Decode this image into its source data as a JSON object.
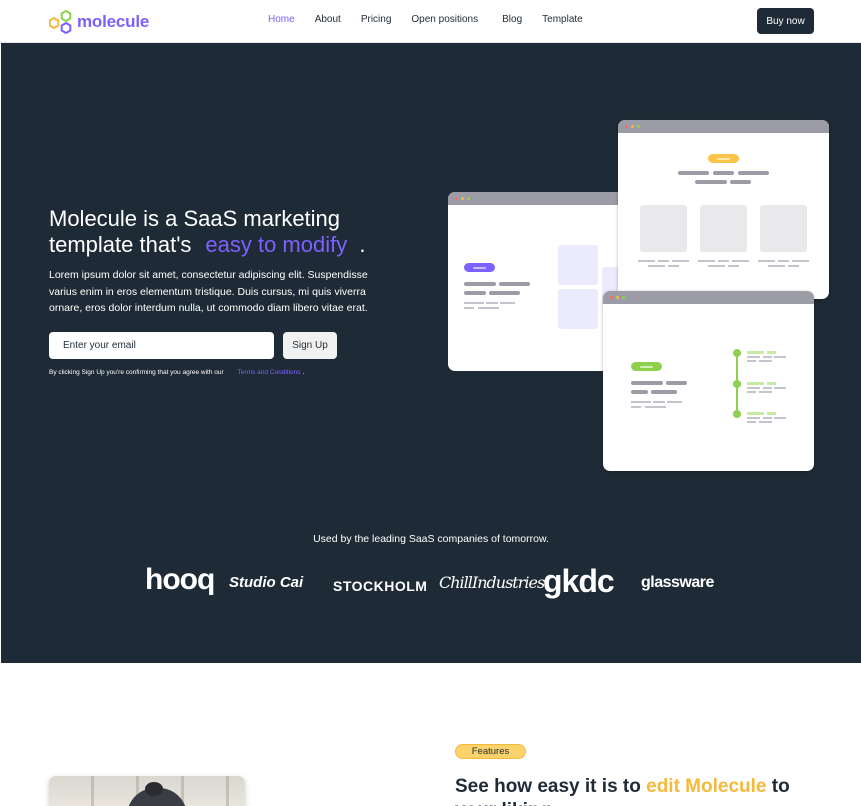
{
  "nav": {
    "logo_text": "molecule",
    "links": [
      "Home",
      "About",
      "Pricing",
      "Open positions",
      "Blog",
      "Template"
    ],
    "active": "Home",
    "buy_label": "Buy now"
  },
  "hero": {
    "title_part1": "Molecule is a SaaS marketing template that's",
    "title_accent": "easy to modify",
    "title_end": ".",
    "description": "Lorem ipsum dolor sit amet, consectetur adipiscing elit. Suspendisse varius enim in eros elementum tristique. Duis cursus, mi quis viverra ornare, eros dolor interdum nulla, ut commodo diam libero vitae erat.",
    "email_placeholder": "Enter your email",
    "signup_label": "Sign Up",
    "consent_text": "By clicking Sign Up you're confirming that you agree with our",
    "terms_text": "Terms and Conditions",
    "consent_end": "."
  },
  "brands": {
    "caption": "Used by the leading SaaS companies of tomorrow.",
    "items": [
      "hooq",
      "Studio Cai",
      "STOCKHOLM",
      "ChillIndustries",
      "gkdc",
      "glassware"
    ]
  },
  "features": {
    "badge": "Features",
    "title_part1": "See how easy it is to",
    "title_accent": "edit Molecule",
    "title_part2": "to your liking"
  },
  "colors": {
    "brand_purple": "#7b61ff",
    "dark_bg": "#1e2b36",
    "accent_yellow": "#f6b93b",
    "accent_green": "#8fd14f"
  }
}
